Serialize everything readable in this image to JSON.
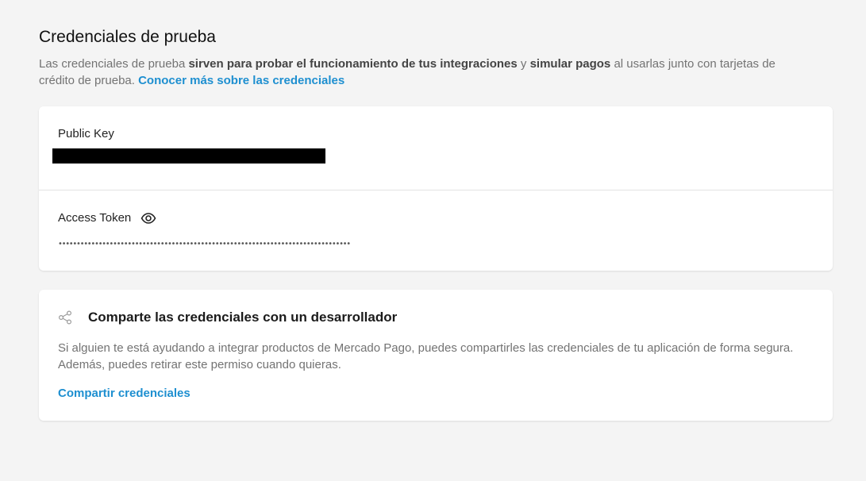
{
  "header": {
    "title": "Credenciales de prueba",
    "intro": {
      "part1": "Las credenciales de prueba ",
      "bold1": "sirven para probar el funcionamiento de tus integraciones",
      "part2": " y ",
      "bold2": "simular pagos",
      "part3": " al usarlas junto con tarjetas de crédito de prueba. ",
      "link": "Conocer más sobre las credenciales"
    }
  },
  "credentials": {
    "public_key": {
      "label": "Public Key"
    },
    "access_token": {
      "label": "Access Token",
      "icon": "eye-icon",
      "masked_value": "••••••••••••••••••••••••••••••••••••••••••••••••••••••••••••••••••••••••••••••••"
    }
  },
  "share": {
    "icon": "share-icon",
    "title": "Comparte las credenciales con un desarrollador",
    "description": "Si alguien te está ayudando a integrar productos de Mercado Pago, puedes compartirles las credenciales de tu aplicación de forma segura. Además, puedes retirar este permiso cuando quieras.",
    "link": "Compartir credenciales"
  },
  "colors": {
    "background": "#f4f4f4",
    "link": "#1e8fd0",
    "muted_text": "#737373"
  }
}
